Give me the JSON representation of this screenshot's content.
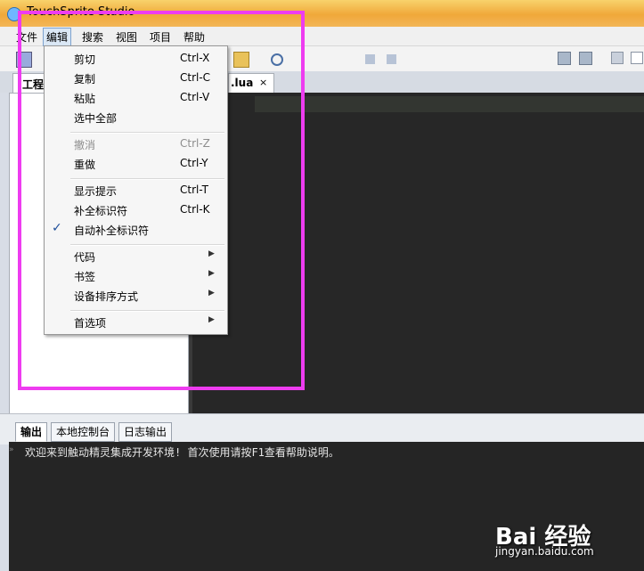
{
  "window": {
    "title": "TouchSprite Studio"
  },
  "menubar": {
    "items": [
      "文件",
      "编辑",
      "搜索",
      "视图",
      "项目",
      "帮助"
    ],
    "active": "编辑"
  },
  "tabs": {
    "project": "工程",
    "file": ".lua"
  },
  "edit_menu": {
    "groups": [
      [
        {
          "label": "剪切",
          "shortcut": "Ctrl-X"
        },
        {
          "label": "复制",
          "shortcut": "Ctrl-C"
        },
        {
          "label": "粘贴",
          "shortcut": "Ctrl-V"
        },
        {
          "label": "选中全部",
          "shortcut": ""
        }
      ],
      [
        {
          "label": "撤消",
          "shortcut": "Ctrl-Z",
          "disabled": true
        },
        {
          "label": "重做",
          "shortcut": "Ctrl-Y"
        }
      ],
      [
        {
          "label": "显示提示",
          "shortcut": "Ctrl-T"
        },
        {
          "label": "补全标识符",
          "shortcut": "Ctrl-K"
        },
        {
          "label": "自动补全标识符",
          "shortcut": "",
          "checked": true
        }
      ],
      [
        {
          "label": "代码",
          "submenu": true
        },
        {
          "label": "书签",
          "submenu": true
        },
        {
          "label": "设备排序方式",
          "submenu": true
        }
      ],
      [
        {
          "label": "首选项",
          "submenu": true
        }
      ]
    ]
  },
  "output_tabs": [
    "输出",
    "本地控制台",
    "日志输出"
  ],
  "output": {
    "message": "欢迎来到触动精灵集成开发环境! 首次使用请按F1查看帮助说明。"
  },
  "watermark": {
    "brand": "Bai 经验",
    "url": "jingyan.baidu.com"
  },
  "colors": {
    "annotation": "#ee3cf0",
    "editor_bg": "#272727",
    "title_bar": "#f0a83a"
  },
  "icons": [
    "new-file-icon",
    "open-icon",
    "search-icon",
    "run-icon",
    "play-icon",
    "stop-icon",
    "pause-icon",
    "record-icon",
    "bookmark-icon",
    "device-icon"
  ]
}
